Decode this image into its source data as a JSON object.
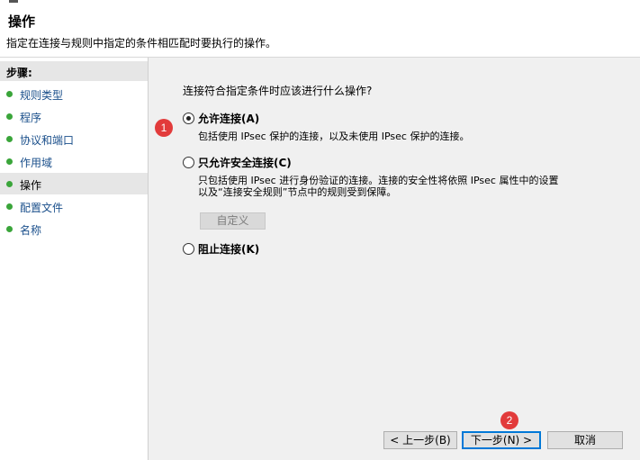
{
  "header": {
    "title": "操作",
    "subtitle": "指定在连接与规则中指定的条件相匹配时要执行的操作。"
  },
  "sidebar": {
    "heading": "步骤:",
    "items": [
      {
        "label": "规则类型"
      },
      {
        "label": "程序"
      },
      {
        "label": "协议和端口"
      },
      {
        "label": "作用域"
      },
      {
        "label": "操作",
        "active": true
      },
      {
        "label": "配置文件"
      },
      {
        "label": "名称"
      }
    ]
  },
  "main": {
    "question": "连接符合指定条件时应该进行什么操作?",
    "options": [
      {
        "label": "允许连接(A)",
        "checked": true,
        "desc": [
          "包括使用 IPsec 保护的连接，以及未使用 IPsec 保护的连接。"
        ]
      },
      {
        "label": "只允许安全连接(C)",
        "checked": false,
        "desc": [
          "只包括使用 IPsec 进行身份验证的连接。连接的安全性将依照 IPsec 属性中的设置",
          "以及“连接安全规则”节点中的规则受到保障。"
        ]
      },
      {
        "label": "阻止连接(K)",
        "checked": false,
        "desc": []
      }
    ],
    "customize_label": "自定义"
  },
  "badges": [
    "1",
    "2"
  ],
  "buttons": {
    "back": "< 上一步(B)",
    "next": "下一步(N) >",
    "cancel": "取消"
  },
  "colors": {
    "step_dot": "#3aa53a",
    "link": "#1a4f8b",
    "badge": "#e23b3b",
    "default_button_border": "#0078d7"
  }
}
